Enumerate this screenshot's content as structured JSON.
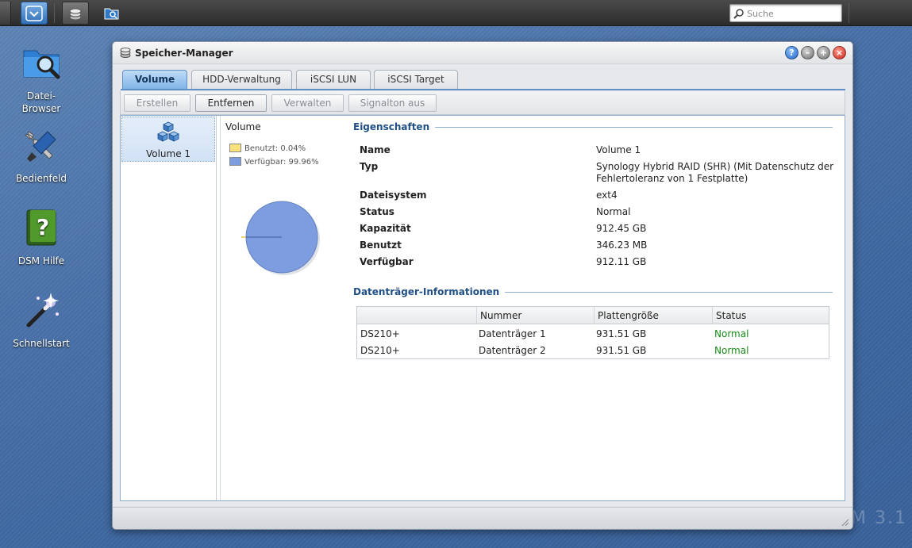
{
  "taskbar": {
    "search_placeholder": "Suche"
  },
  "desktop": {
    "icons": [
      {
        "label_line1": "Datei-",
        "label_line2": "Browser"
      },
      {
        "label_line1": "Bedienfeld"
      },
      {
        "label_line1": "DSM Hilfe"
      },
      {
        "label_line1": "Schnellstart"
      }
    ],
    "watermark": "M 3.1"
  },
  "window": {
    "title": "Speicher-Manager",
    "tabs": [
      "Volume",
      "HDD-Verwaltung",
      "iSCSI LUN",
      "iSCSI Target"
    ],
    "active_tab": "Volume",
    "toolbar": {
      "create": "Erstellen",
      "remove": "Entfernen",
      "manage": "Verwalten",
      "beep_off": "Signalton aus"
    },
    "volumes": [
      {
        "label": "Volume 1"
      }
    ],
    "usage_panel": {
      "title": "Volume",
      "used_label": "Benutzt: 0.04%",
      "free_label": "Verfügbar: 99.96%",
      "used_fraction": 0.0004,
      "colors": {
        "used": "#f9e27a",
        "free": "#7e9de0"
      }
    },
    "properties": {
      "section_title": "Eigenschaften",
      "rows": [
        {
          "key": "Name",
          "value": "Volume 1"
        },
        {
          "key": "Typ",
          "value": "Synology Hybrid RAID (SHR) (Mit Datenschutz der Fehlertoleranz von 1 Festplatte)"
        },
        {
          "key": "Dateisystem",
          "value": "ext4"
        },
        {
          "key": "Status",
          "value": "Normal"
        },
        {
          "key": "Kapazität",
          "value": "912.45 GB"
        },
        {
          "key": "Benutzt",
          "value": "346.23 MB"
        },
        {
          "key": "Verfügbar",
          "value": "912.11 GB"
        }
      ]
    },
    "disks": {
      "section_title": "Datenträger-Informationen",
      "columns": [
        "",
        "Nummer",
        "Plattengröße",
        "Status"
      ],
      "rows": [
        [
          "DS210+",
          "Datenträger 1",
          "931.51 GB",
          "Normal"
        ],
        [
          "DS210+",
          "Datenträger 2",
          "931.51 GB",
          "Normal"
        ]
      ],
      "status_ok_color": "#1a8a1a"
    }
  }
}
